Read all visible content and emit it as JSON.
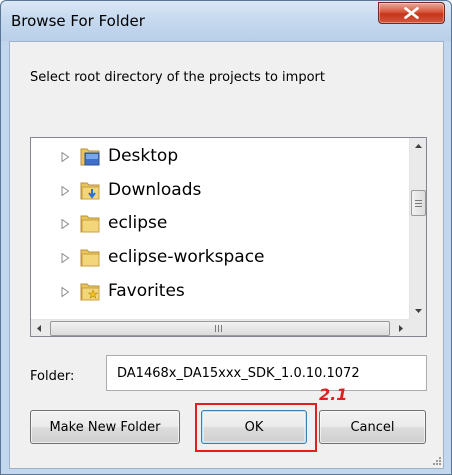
{
  "window": {
    "title": "Browse For Folder",
    "close_icon": "close-icon",
    "close_color": "#c5351a"
  },
  "dialog": {
    "instruction": "Select root directory of the projects to import"
  },
  "tree": {
    "items": [
      {
        "label": "Desktop",
        "icon": "desktop-folder-icon"
      },
      {
        "label": "Downloads",
        "icon": "downloads-folder-icon"
      },
      {
        "label": "eclipse",
        "icon": "folder-icon"
      },
      {
        "label": "eclipse-workspace",
        "icon": "folder-icon"
      },
      {
        "label": "Favorites",
        "icon": "favorites-folder-icon"
      }
    ],
    "hscroll_grip": "III"
  },
  "folder": {
    "label": "Folder:",
    "value": "DA1468x_DA15xxx_SDK_1.0.10.1072"
  },
  "buttons": {
    "make_new_folder": "Make New Folder",
    "ok": "OK",
    "cancel": "Cancel"
  },
  "annotation": {
    "step_label": "2.1",
    "color": "#e02020"
  }
}
